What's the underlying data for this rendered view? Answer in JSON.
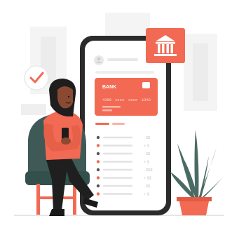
{
  "card": {
    "bank_label": "BANK",
    "numbers": [
      "4356",
      "xxxx",
      "xxxx",
      "1342"
    ]
  },
  "transactions": [
    {
      "dot": "#555555",
      "amount": "- $$"
    },
    {
      "dot": "#f26a54",
      "amount": "+ $"
    },
    {
      "dot": "#555555",
      "amount": "- $$"
    },
    {
      "dot": "#f26a54",
      "amount": "+ $"
    },
    {
      "dot": "#555555",
      "amount": "- $$$"
    },
    {
      "dot": "#f26a54",
      "amount": "+ $$"
    },
    {
      "dot": "#555555",
      "amount": "- $$"
    },
    {
      "dot": "#f26a54",
      "amount": "+ $"
    }
  ],
  "colors": {
    "accent": "#f26a54",
    "phone_frame": "#2b2b2b",
    "chair": "#3f5a56",
    "plant": "#4a6b63",
    "pot": "#f26a54"
  },
  "icons": {
    "bank": "bank-building-icon",
    "check": "check-icon",
    "profile": "user-avatar-icon"
  }
}
